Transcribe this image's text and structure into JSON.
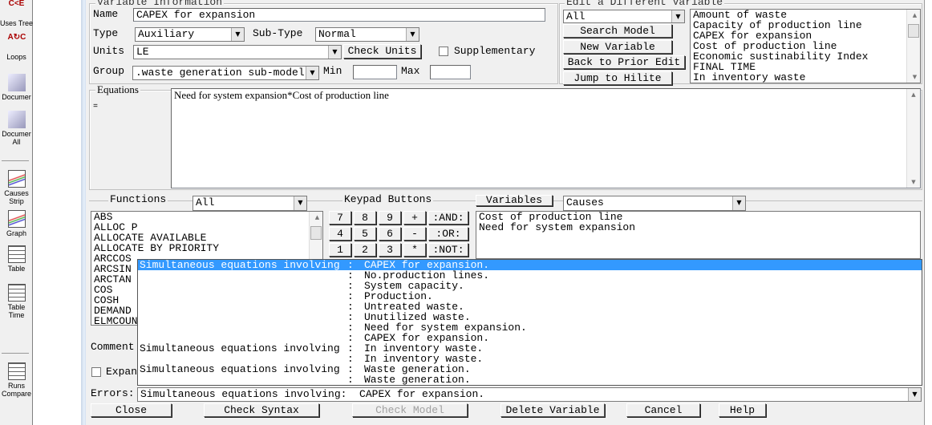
{
  "toolbar": {
    "items": [
      {
        "label": "Uses Tree",
        "icon": "uses-tree-icon"
      },
      {
        "label": "Loops",
        "icon": "loops-icon"
      },
      {
        "label": "Documer",
        "icon": "document-icon"
      },
      {
        "label": "Documer All",
        "icon": "document-all-icon"
      },
      {
        "label": "Causes Strip",
        "icon": "causes-strip-icon"
      },
      {
        "label": "Graph",
        "icon": "graph-icon"
      },
      {
        "label": "Table",
        "icon": "table-icon"
      },
      {
        "label": "Table Time",
        "icon": "table-time-icon"
      },
      {
        "label": "Runs Compare",
        "icon": "runs-compare-icon"
      }
    ]
  },
  "variable_info": {
    "title": "Variable Information",
    "name_label": "Name",
    "name_value": "CAPEX for expansion",
    "type_label": "Type",
    "type_value": "Auxiliary",
    "subtype_label": "Sub-Type",
    "subtype_value": "Normal",
    "units_label": "Units",
    "units_value": "LE",
    "check_units": "Check Units",
    "supplementary_label": "Supplementary",
    "supplementary_checked": false,
    "group_label": "Group",
    "group_value": ".waste generation sub-model",
    "min_label": "Min",
    "min_value": "",
    "max_label": "Max",
    "max_value": ""
  },
  "edit_variable": {
    "title": "Edit a Different Variable",
    "filter": "All",
    "search_model": "Search Model",
    "new_variable": "New Variable",
    "back": "Back to Prior Edit",
    "jump": "Jump to Hilite",
    "list": [
      "Amount of waste",
      "Capacity of production line",
      "CAPEX for expansion",
      "Cost of production line",
      "Economic sustinability Index",
      "FINAL TIME",
      "In inventory waste"
    ]
  },
  "equations": {
    "title": "Equations",
    "operator": "=",
    "value": "Need for system expansion*Cost of production line"
  },
  "functions": {
    "title": "Functions",
    "filter": "All",
    "list": [
      "ABS",
      "ALLOC P",
      "ALLOCATE AVAILABLE",
      "ALLOCATE BY PRIORITY",
      "ARCCOS",
      "ARCSIN",
      "ARCTAN",
      "COS",
      "COSH",
      "DEMAND",
      "ELMCOUNT"
    ]
  },
  "keypad": {
    "title": "Keypad Buttons",
    "rows": [
      [
        "7",
        "8",
        "9",
        "+",
        ":AND:"
      ],
      [
        "4",
        "5",
        "6",
        "-",
        ":OR:"
      ],
      [
        "1",
        "2",
        "3",
        "*",
        ":NOT:"
      ]
    ]
  },
  "variables": {
    "button": "Variables",
    "filter": "Causes",
    "list": [
      "Cost of production line",
      "Need for system expansion"
    ]
  },
  "comment_label": "Comment",
  "expand_label": "Expand",
  "errors": {
    "label": "Errors:",
    "value": "Simultaneous equations involving:  CAPEX for expansion.",
    "options": [
      {
        "prefix": "Simultaneous equations involving",
        "var": "CAPEX for expansion."
      },
      {
        "prefix": "",
        "var": "No.production lines."
      },
      {
        "prefix": "",
        "var": "System capacity."
      },
      {
        "prefix": "",
        "var": "Production."
      },
      {
        "prefix": "",
        "var": "Untreated waste."
      },
      {
        "prefix": "",
        "var": "Unutilized waste."
      },
      {
        "prefix": "",
        "var": "Need for system expansion."
      },
      {
        "prefix": "",
        "var": "CAPEX for expansion."
      },
      {
        "prefix": "Simultaneous equations involving",
        "var": "In inventory waste."
      },
      {
        "prefix": "",
        "var": "In inventory waste."
      },
      {
        "prefix": "Simultaneous equations involving",
        "var": "Waste generation."
      },
      {
        "prefix": "",
        "var": "Waste generation."
      }
    ]
  },
  "buttons": {
    "close": "Close",
    "check_syntax": "Check Syntax",
    "check_model": "Check Model",
    "delete_variable": "Delete Variable",
    "cancel": "Cancel",
    "help": "Help"
  },
  "colors": {
    "highlight": "#3399ff",
    "dialog_bg": "#f0f0f0"
  }
}
